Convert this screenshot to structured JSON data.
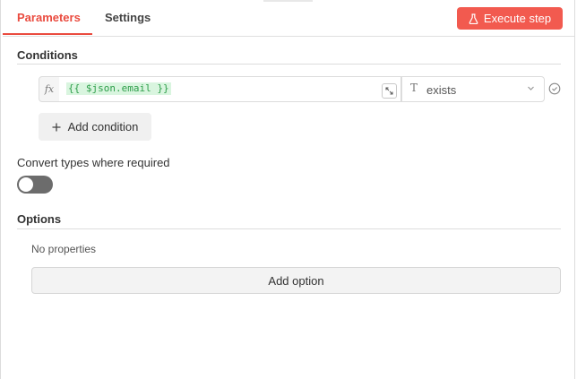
{
  "tabs": [
    {
      "label": "Parameters",
      "active": true
    },
    {
      "label": "Settings",
      "active": false
    }
  ],
  "execute_button": {
    "label": "Execute step",
    "icon": "flask-icon",
    "color": "#f25a4f"
  },
  "conditions": {
    "title": "Conditions",
    "rows": [
      {
        "fx_label": "fx",
        "expression": "{{ $json.email }}",
        "operator_type_icon": "T",
        "operator": "exists"
      }
    ],
    "add_condition_label": "Add condition"
  },
  "convert_types": {
    "label": "Convert types where required",
    "enabled": false
  },
  "options": {
    "title": "Options",
    "empty_text": "No properties",
    "add_option_label": "Add option"
  },
  "colors": {
    "accent": "#ea4b3f",
    "expression_bg": "#d9f5df",
    "expression_text": "#2e9e4a"
  }
}
